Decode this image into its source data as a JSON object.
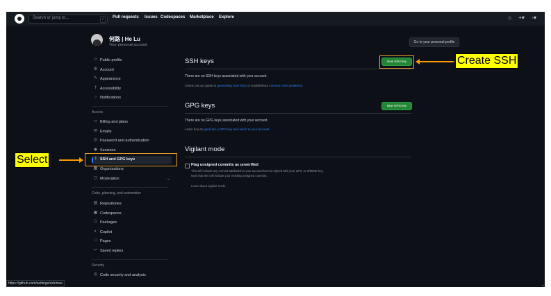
{
  "topbar": {
    "search_placeholder": "Search or jump to...",
    "slash_hint": "/",
    "nav": [
      "Pull requests",
      "Issues",
      "Codespaces",
      "Marketplace",
      "Explore"
    ],
    "icons": [
      "bell-icon",
      "plus-icon",
      "avatar-menu"
    ]
  },
  "profile": {
    "name": "何路 | He Lu",
    "subtitle": "Your personal account",
    "go_button": "Go to your personal profile"
  },
  "sidebar": {
    "items": [
      {
        "label": "Public profile",
        "icon": "person-icon"
      },
      {
        "label": "Account",
        "icon": "gear-icon"
      },
      {
        "label": "Appearance",
        "icon": "paintbrush-icon"
      },
      {
        "label": "Accessibility",
        "icon": "accessibility-icon"
      },
      {
        "label": "Notifications",
        "icon": "bell-icon"
      }
    ],
    "access_heading": "Access",
    "access_items": [
      {
        "label": "Billing and plans",
        "icon": "credit-card-icon"
      },
      {
        "label": "Emails",
        "icon": "mail-icon"
      },
      {
        "label": "Password and authentication",
        "icon": "shield-icon"
      },
      {
        "label": "Sessions",
        "icon": "broadcast-icon"
      },
      {
        "label": "SSH and GPG keys",
        "icon": "key-icon"
      },
      {
        "label": "Organizations",
        "icon": "organization-icon"
      },
      {
        "label": "Moderation",
        "icon": "report-icon"
      }
    ],
    "code_heading": "Code, planning, and automation",
    "code_items": [
      {
        "label": "Repositories",
        "icon": "repo-icon"
      },
      {
        "label": "Codespaces",
        "icon": "codespaces-icon"
      },
      {
        "label": "Packages",
        "icon": "package-icon"
      },
      {
        "label": "Copilot",
        "icon": "copilot-icon"
      },
      {
        "label": "Pages",
        "icon": "browser-icon"
      },
      {
        "label": "Saved replies",
        "icon": "reply-icon"
      }
    ],
    "security_heading": "Security",
    "security_items": [
      {
        "label": "Code security and analysis",
        "icon": "codescan-icon"
      }
    ]
  },
  "ssh": {
    "title": "SSH keys",
    "button": "New SSH key",
    "empty": "There are no SSH keys associated with your account.",
    "help_pre": "Check out our guide to ",
    "help_link1": "generating SSH keys",
    "help_mid": " or troubleshoot ",
    "help_link2": "common SSH problems",
    "help_post": "."
  },
  "gpg": {
    "title": "GPG keys",
    "button": "New GPG key",
    "empty": "There are no GPG keys associated with your account.",
    "help_pre": "Learn how to ",
    "help_link": "generate a GPG key and add it to your account",
    "help_post": "."
  },
  "vigilant": {
    "title": "Vigilant mode",
    "checkbox_label": "Flag unsigned commits as unverified",
    "desc1": "This will include any commit attributed to your account but not signed with your GPG or S/MIME key.",
    "desc2": "Note that this will include your existing unsigned commits.",
    "link": "Learn about vigilant mode."
  },
  "status_url": "https://github.com/settings/ssh/new",
  "annotations": {
    "select": "Select",
    "create": "Create SSH"
  },
  "colors": {
    "background": "#0d1117",
    "accent": "#2f81f7",
    "button_green": "#238636",
    "callout": "#ffff00",
    "arrow": "#ff9a00"
  }
}
